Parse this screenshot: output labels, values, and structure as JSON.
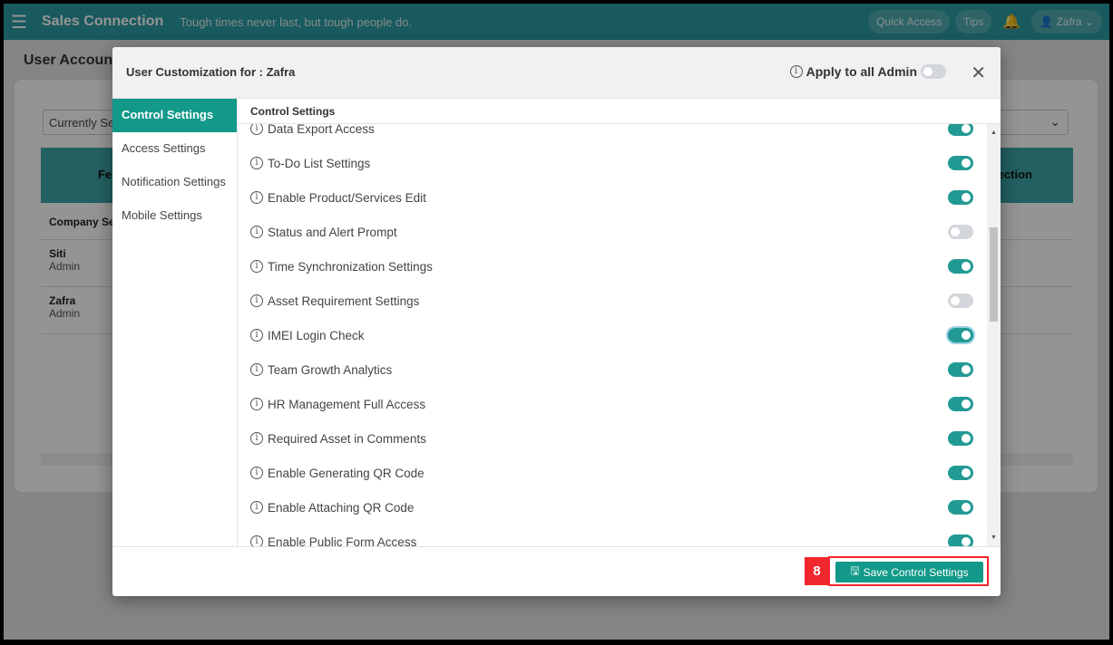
{
  "topbar": {
    "menu_icon": "hamburger-icon",
    "brand": "Sales Connection",
    "tagline": "Tough times never last, but tough people do.",
    "quick_access": "Quick Access",
    "tips": "Tips",
    "user": "Zafra"
  },
  "background": {
    "page_title": "User Account",
    "select_value": "Currently Se",
    "table_header_left": "Fe",
    "table_header_right": "ection",
    "rows": [
      {
        "name": "Company Se",
        "role": ""
      },
      {
        "name": "Siti",
        "role": "Admin"
      },
      {
        "name": "Zafra",
        "role": "Admin"
      }
    ]
  },
  "modal": {
    "title": "User Customization for : Zafra",
    "apply_label": "Apply to all Admin",
    "apply_on": false,
    "nav": [
      "Control Settings",
      "Access Settings",
      "Notification Settings",
      "Mobile Settings"
    ],
    "section_title": "Control Settings",
    "settings": [
      {
        "label": "Data Export Access",
        "on": true
      },
      {
        "label": "To-Do List Settings",
        "on": true
      },
      {
        "label": "Enable Product/Services Edit",
        "on": true
      },
      {
        "label": "Status and Alert Prompt",
        "on": false
      },
      {
        "label": "Time Synchronization Settings",
        "on": true
      },
      {
        "label": "Asset Requirement Settings",
        "on": false
      },
      {
        "label": "IMEI Login Check",
        "on": true
      },
      {
        "label": "Team Growth Analytics",
        "on": true
      },
      {
        "label": "HR Management Full Access",
        "on": true
      },
      {
        "label": "Required Asset in Comments",
        "on": true
      },
      {
        "label": "Enable Generating QR Code",
        "on": true
      },
      {
        "label": "Enable Attaching QR Code",
        "on": true
      },
      {
        "label": "Enable Public Form Access",
        "on": true
      }
    ],
    "save_label": "Save Control Settings",
    "step_badge": "8"
  },
  "colors": {
    "accent": "#12998a",
    "toggle_on": "#229a94",
    "highlight": "#f2272d"
  }
}
